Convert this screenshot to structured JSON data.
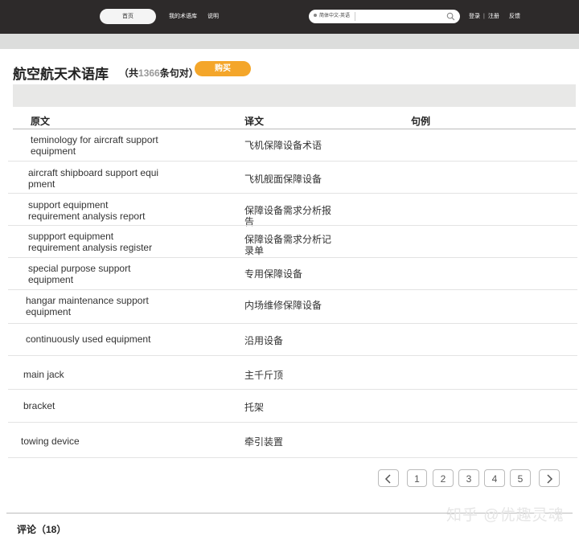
{
  "nav": {
    "home": "首页",
    "my_library": "我的术语库",
    "help": "说明",
    "search_lang": "简体中文-英语",
    "search_placeholder": "",
    "login": "登录",
    "separator": "|",
    "register": "注册",
    "feedback": "反馈"
  },
  "header": {
    "title": "航空航天术语库",
    "count_prefix": "（共",
    "count_value": "1366",
    "count_suffix": "条句对）",
    "buy_label": "购买"
  },
  "table": {
    "columns": [
      "原文",
      "译文",
      "句例"
    ],
    "rows": [
      {
        "source": "teminology for aircraft support\nequipment",
        "target": "飞机保障设备术语"
      },
      {
        "source": "aircraft shipboard support equi\npment",
        "target": "飞机舰面保障设备"
      },
      {
        "source": "support equipment\nrequirement analysis report",
        "target": "保障设备需求分析报\n告"
      },
      {
        "source": "suppport equipment\nrequirement analysis register",
        "target": "保障设备需求分析记\n录单"
      },
      {
        "source": "special purpose support\nequipment",
        "target": "专用保障设备"
      },
      {
        "source": "hangar maintenance support\nequipment",
        "target": "内场维修保障设备"
      },
      {
        "source": "continuously used equipment",
        "target": "沿用设备"
      },
      {
        "source": "main jack",
        "target": "主千斤顶"
      },
      {
        "source": "bracket",
        "target": "托架"
      },
      {
        "source": "towing device",
        "target": "牵引装置"
      }
    ]
  },
  "pagination": {
    "pages": [
      "1",
      "2",
      "3",
      "4",
      "5"
    ],
    "prev_icon": "chevron-left-icon",
    "next_icon": "chevron-right-icon"
  },
  "comments": {
    "label": "评论（18）"
  },
  "watermark": "知乎 @优趣灵魂",
  "colors": {
    "nav_bg": "#2d2a2a",
    "accent": "#f4a62a",
    "filter_bg": "#e8e8e7"
  }
}
